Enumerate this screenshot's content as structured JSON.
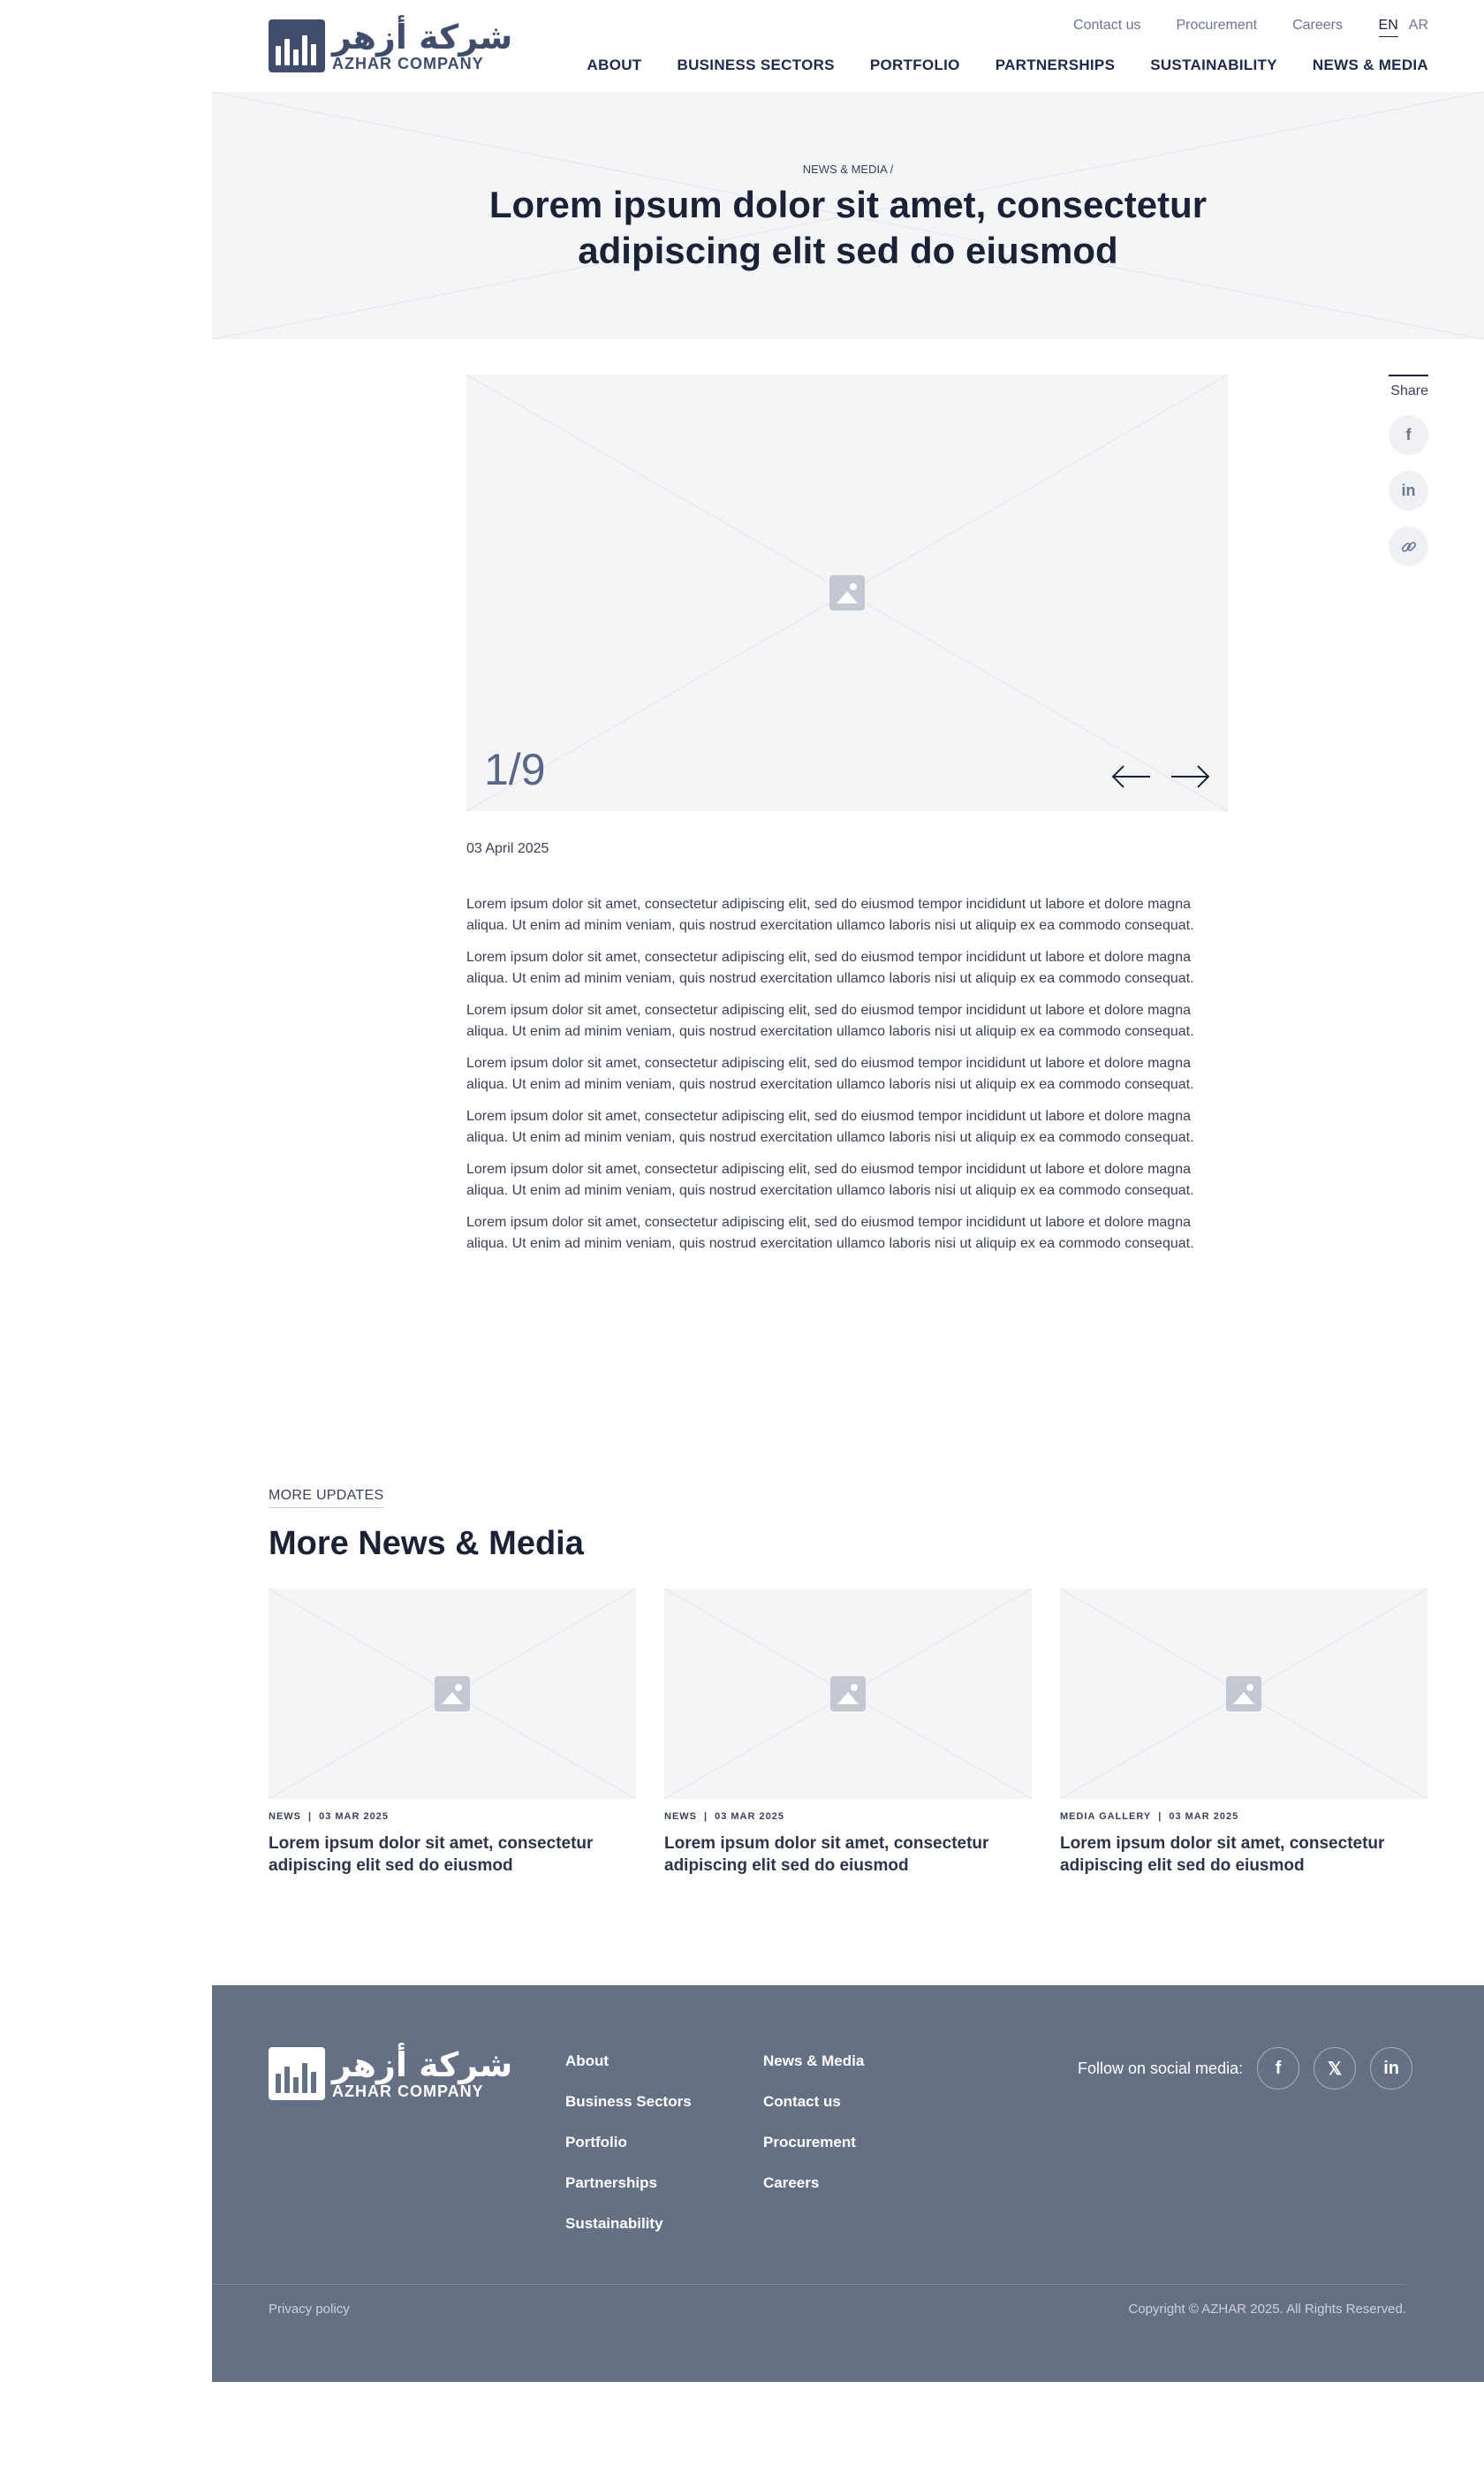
{
  "header": {
    "logo_ar": "شركة أزهر",
    "logo_en": "AZHAR COMPANY",
    "top_links": [
      "Contact us",
      "Procurement",
      "Careers"
    ],
    "lang": {
      "en": "EN",
      "ar": "AR"
    },
    "nav": [
      "ABOUT",
      "BUSINESS SECTORS",
      "PORTFOLIO",
      "PARTNERSHIPS",
      "SUSTAINABILITY",
      "NEWS & MEDIA"
    ]
  },
  "hero": {
    "breadcrumb": "NEWS & MEDIA /",
    "title": "Lorem ipsum dolor sit amet, consectetur adipiscing elit sed do eiusmod"
  },
  "gallery": {
    "counter": "1/9",
    "prev_icon": "arrow-left-icon",
    "next_icon": "arrow-right-icon"
  },
  "share": {
    "label": "Share",
    "icons": [
      "facebook-icon",
      "linkedin-icon",
      "link-icon"
    ]
  },
  "article": {
    "date": "03 April 2025",
    "paragraphs": [
      "Lorem ipsum dolor sit amet, consectetur adipiscing elit, sed do eiusmod tempor incididunt ut labore et dolore magna aliqua. Ut enim ad minim veniam, quis nostrud exercitation ullamco laboris nisi ut aliquip ex ea commodo consequat.",
      "Lorem ipsum dolor sit amet, consectetur adipiscing elit, sed do eiusmod tempor incididunt ut labore et dolore magna aliqua. Ut enim ad minim veniam, quis nostrud exercitation ullamco laboris nisi ut aliquip ex ea commodo consequat.",
      "Lorem ipsum dolor sit amet, consectetur adipiscing elit, sed do eiusmod tempor incididunt ut labore et dolore magna aliqua. Ut enim ad minim veniam, quis nostrud exercitation ullamco laboris nisi ut aliquip ex ea commodo consequat.",
      "Lorem ipsum dolor sit amet, consectetur adipiscing elit, sed do eiusmod tempor incididunt ut labore et dolore magna aliqua. Ut enim ad minim veniam, quis nostrud exercitation ullamco laboris nisi ut aliquip ex ea commodo consequat.",
      "Lorem ipsum dolor sit amet, consectetur adipiscing elit, sed do eiusmod tempor incididunt ut labore et dolore magna aliqua. Ut enim ad minim veniam, quis nostrud exercitation ullamco laboris nisi ut aliquip ex ea commodo consequat.",
      "Lorem ipsum dolor sit amet, consectetur adipiscing elit, sed do eiusmod tempor incididunt ut labore et dolore magna aliqua. Ut enim ad minim veniam, quis nostrud exercitation ullamco laboris nisi ut aliquip ex ea commodo consequat.",
      "Lorem ipsum dolor sit amet, consectetur adipiscing elit, sed do eiusmod tempor incididunt ut labore et dolore magna aliqua. Ut enim ad minim veniam, quis nostrud exercitation ullamco laboris nisi ut aliquip ex ea commodo consequat."
    ]
  },
  "more": {
    "eyebrow": "MORE UPDATES",
    "title": "More News & Media",
    "cards": [
      {
        "category": "NEWS",
        "date": "03 MAR 2025",
        "title": "Lorem ipsum dolor sit amet, consectetur adipiscing elit sed do eiusmod"
      },
      {
        "category": "NEWS",
        "date": "03 MAR 2025",
        "title": "Lorem ipsum dolor sit amet, consectetur adipiscing elit sed do eiusmod"
      },
      {
        "category": "MEDIA GALLERY",
        "date": "03 MAR 2025",
        "title": "Lorem ipsum dolor sit amet, consectetur adipiscing elit sed do eiusmod"
      }
    ]
  },
  "footer": {
    "logo_ar": "شركة أزهر",
    "logo_en": "AZHAR COMPANY",
    "col1": [
      "About",
      "Business Sectors",
      "Portfolio",
      "Partnerships",
      "Sustainability"
    ],
    "col2": [
      "News & Media",
      "Contact us",
      "Procurement",
      "Careers"
    ],
    "social_label": "Follow on social media:",
    "social_icons": [
      "facebook-icon",
      "x-icon",
      "linkedin-icon"
    ],
    "privacy": "Privacy policy",
    "copyright": "Copyright © AZHAR 2025. All Rights Reserved."
  },
  "colors": {
    "brand": "#3f4d6b",
    "footer_bg": "#667085",
    "placeholder_bg": "#f4f5f7"
  }
}
